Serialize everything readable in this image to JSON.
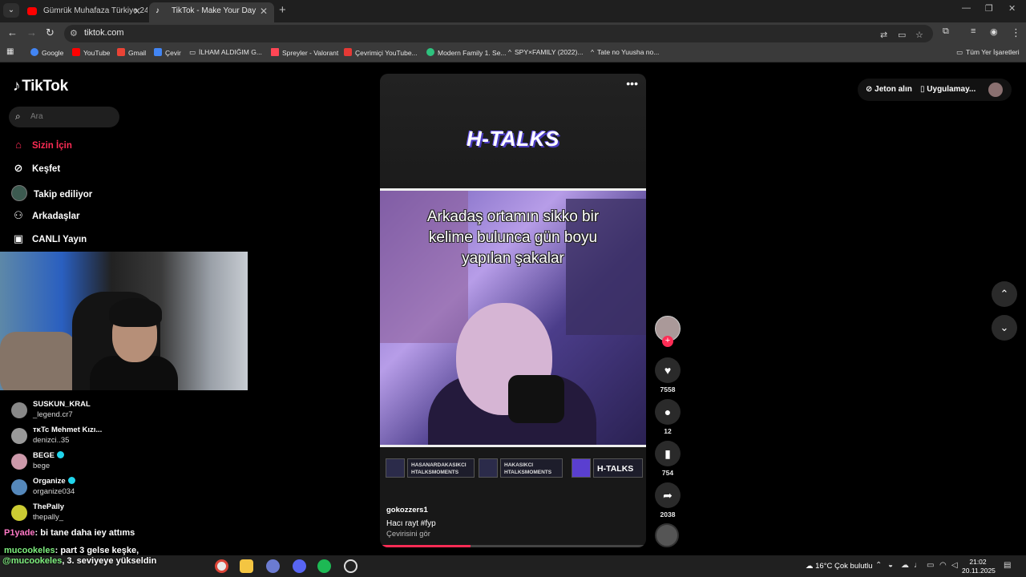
{
  "browser": {
    "tabs": [
      {
        "title": "Gümrük Muhafaza Türkiye 24.",
        "favicon": "youtube-icon",
        "active": false
      },
      {
        "title": "TikTok - Make Your Day",
        "favicon": "tiktok-icon",
        "active": true
      }
    ],
    "url": "tiktok.com",
    "bookmarks": [
      {
        "label": "Google",
        "icon": "google-icon",
        "color": "#4285f4"
      },
      {
        "label": "YouTube",
        "icon": "youtube-icon",
        "color": "#ff0000"
      },
      {
        "label": "Gmail",
        "icon": "gmail-icon",
        "color": "#ea4335"
      },
      {
        "label": "Çevir",
        "icon": "translate-icon",
        "color": "#4285f4"
      },
      {
        "label": "İLHAM ALDIĞIM G...",
        "icon": "folder-icon",
        "color": "#cfcfcf"
      },
      {
        "label": "Spreyler - Valorant",
        "icon": "valorant-icon",
        "color": "#ff4655"
      },
      {
        "label": "Çevrimiçi YouTube...",
        "icon": "download-icon",
        "color": "#e53935"
      },
      {
        "label": "Modern Family 1. Se...",
        "icon": "streaming-icon",
        "color": "#2ec27e"
      },
      {
        "label": "SPY×FAMILY (2022)...",
        "icon": "anime-icon",
        "color": "#cfcfcf"
      },
      {
        "label": "Tate no Yuusha no...",
        "icon": "anime-icon",
        "color": "#cfcfcf"
      }
    ],
    "all_bookmarks": "Tüm Yer İşaretleri"
  },
  "tiktok": {
    "brand": "TikTok",
    "search_placeholder": "Ara",
    "nav": [
      {
        "label": "Sizin İçin",
        "icon": "home-icon",
        "active": true
      },
      {
        "label": "Keşfet",
        "icon": "compass-icon",
        "active": false
      },
      {
        "label": "Takip ediliyor",
        "icon": "following-avatar",
        "active": false
      },
      {
        "label": "Arkadaşlar",
        "icon": "friends-icon",
        "active": false
      },
      {
        "label": "CANLI Yayın",
        "icon": "live-icon",
        "active": false
      }
    ],
    "topbar": {
      "coins": "Jeton alın",
      "app": "Uygulamay..."
    },
    "video": {
      "brand_text": "H-TALKS",
      "caption_lines": [
        "Arkadaş ortamın sikko bir",
        "kelime bulunca gün boyu",
        "yapılan şakalar"
      ],
      "socials": [
        {
          "line1": "HASANARDAKASIKCI",
          "line2": "HTALKSMOMENTS",
          "icon": "instagram-icon"
        },
        {
          "line1": "HAKASIKCI",
          "line2": "HTALKSMOMENTS",
          "icon": "twitter-icon"
        },
        {
          "line1": "H-TALKS",
          "line2": "",
          "icon": "twitch-icon"
        }
      ],
      "author": "gokozzers1",
      "description": "Hacı rayt #fyp",
      "translate": "Çevirisini gör",
      "progress": 0.34
    },
    "actions": {
      "likes": "7558",
      "comments": "12",
      "saves": "754",
      "shares": "2038"
    }
  },
  "overlay": {
    "suggested": [
      {
        "name": "SUSKUN_KRAL",
        "handle": "_legend.cr7",
        "verified": false
      },
      {
        "name": "ᴛᴋTc Mehmet Kızı...",
        "handle": "denizci..35",
        "verified": false
      },
      {
        "name": "BEGE",
        "handle": "bege",
        "verified": true
      },
      {
        "name": "Organize",
        "handle": "organize034",
        "verified": true
      },
      {
        "name": "ThePally",
        "handle": "thepally_",
        "verified": false
      }
    ],
    "chat": [
      {
        "user": "P1yade",
        "message": ": bi tane daha iey attıms"
      },
      {
        "user": "mucookeles",
        "message": ": part 3 gelse keşke,"
      }
    ],
    "toast_user": "@mucookeles",
    "toast_text": ", 3. seviyeye yükseldin"
  },
  "taskbar": {
    "weather": "16°C  Çok bulutlu",
    "time": "21:02",
    "date": "20.11.2025"
  }
}
